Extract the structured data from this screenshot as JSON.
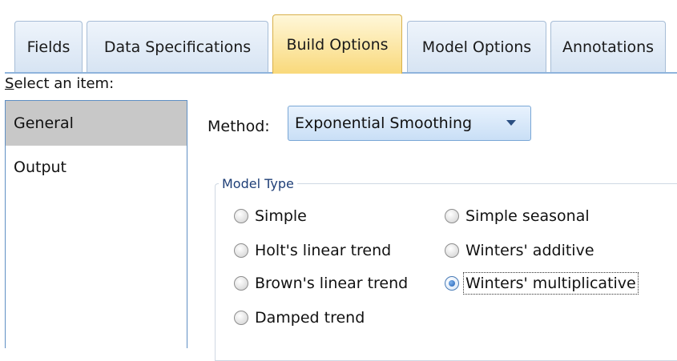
{
  "tabs": [
    {
      "label": "Fields",
      "active": false
    },
    {
      "label": "Data Specifications",
      "active": false
    },
    {
      "label": "Build Options",
      "active": true
    },
    {
      "label": "Model Options",
      "active": false
    },
    {
      "label": "Annotations",
      "active": false
    }
  ],
  "select_label": {
    "mnemonic": "S",
    "rest": "elect an item:"
  },
  "items": [
    {
      "label": "General",
      "selected": true
    },
    {
      "label": "Output",
      "selected": false
    }
  ],
  "method": {
    "label": "Method:",
    "value": "Exponential Smoothing"
  },
  "model_type": {
    "title": "Model Type",
    "options": [
      {
        "label": "Simple",
        "checked": false
      },
      {
        "label": "Holt's linear trend",
        "checked": false
      },
      {
        "label": "Brown's linear trend",
        "checked": false
      },
      {
        "label": "Damped trend",
        "checked": false
      },
      {
        "label": "Simple seasonal",
        "checked": false
      },
      {
        "label": "Winters' additive",
        "checked": false
      },
      {
        "label": "Winters' multiplicative",
        "checked": true
      }
    ]
  },
  "colors": {
    "active_tab": "#f9d97b",
    "tab": "#d7e4f3",
    "selected_item": "#c8c8c8",
    "accent": "#1f5fb4"
  }
}
